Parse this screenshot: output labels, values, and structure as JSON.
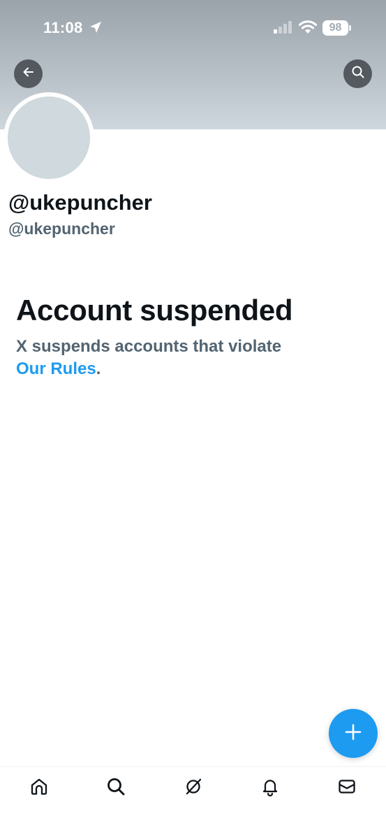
{
  "status_bar": {
    "time": "11:08",
    "battery_level": "98",
    "icons": [
      "location-arrow-icon",
      "cellular-signal-icon",
      "wifi-icon",
      "battery-icon"
    ]
  },
  "header": {
    "back_icon": "arrow-left-icon",
    "search_icon": "search-icon"
  },
  "profile": {
    "display_name": "@ukepuncher",
    "handle": "@ukepuncher"
  },
  "suspension": {
    "title": "Account suspended",
    "message": "X suspends accounts that violate",
    "link_text": "Our Rules",
    "trailing": "."
  },
  "fab": {
    "icon": "plus-icon"
  },
  "tab_bar": {
    "items": [
      {
        "name": "home",
        "icon": "home-icon"
      },
      {
        "name": "search",
        "icon": "search-icon"
      },
      {
        "name": "grok",
        "icon": "grok-icon"
      },
      {
        "name": "notifications",
        "icon": "bell-icon"
      },
      {
        "name": "messages",
        "icon": "envelope-icon"
      }
    ]
  },
  "colors": {
    "accent": "#1d9bf0",
    "primary_text": "#0f1419",
    "secondary_text": "#536471",
    "avatar_placeholder": "#cfd9de"
  }
}
